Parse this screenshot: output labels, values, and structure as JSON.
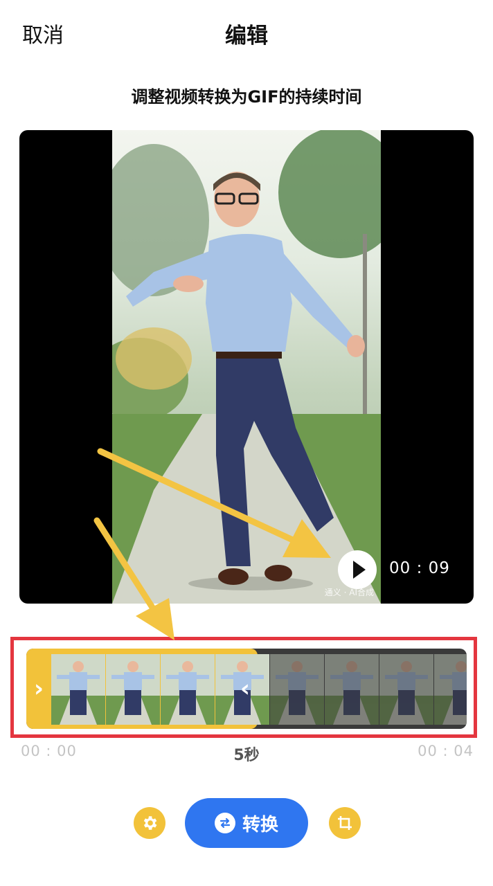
{
  "header": {
    "cancel_label": "取消",
    "title": "编辑"
  },
  "subtitle": "调整视频转换为GIF的持续时间",
  "preview": {
    "duration_label": "00 : 09",
    "watermark": "通义 · AI合成"
  },
  "timeline": {
    "start_label": "00 : 00",
    "end_label": "00 : 04",
    "selection_label": "5秒",
    "selected_frames": 4,
    "total_frames": 8
  },
  "controls": {
    "convert_label": "转换"
  },
  "icons": {
    "play": "play-icon",
    "settings": "gear-icon",
    "convert": "swap-arrows-icon",
    "crop": "crop-icon",
    "handle_left": "chevron-right-icon",
    "handle_right": "chevron-left-icon"
  },
  "colors": {
    "accent_yellow": "#f2c23a",
    "primary_blue": "#2f76f0",
    "highlight_red": "#e4363f",
    "annotation_arrow": "#f3c443"
  }
}
